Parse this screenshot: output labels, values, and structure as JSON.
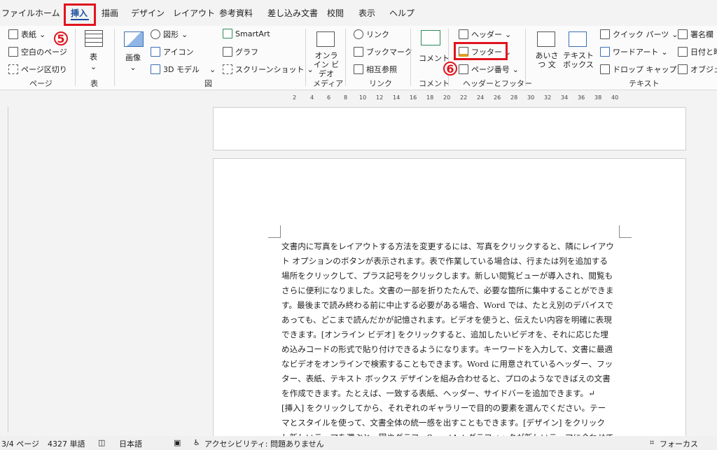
{
  "menu": {
    "tabs": [
      "ファイル",
      "ホーム",
      "挿入",
      "描画",
      "デザイン",
      "レイアウト",
      "参考資料",
      "差し込み文書",
      "校閲",
      "表示",
      "ヘルプ"
    ],
    "active": "挿入"
  },
  "ribbon": {
    "page_group": {
      "cover": "表紙",
      "blank": "空白のページ",
      "break": "ページ区切り",
      "label": "ページ"
    },
    "table_group": {
      "table": "表",
      "label": "表"
    },
    "illust_group": {
      "image": "画像",
      "shapes": "図形",
      "icons": "アイコン",
      "model3d": "3D モデル",
      "smartart": "SmartArt",
      "graph": "グラフ",
      "screenshot": "スクリーンショット",
      "label": "図"
    },
    "media_group": {
      "video": "オンライン ビデオ",
      "label": "メディア"
    },
    "link_group": {
      "link": "リンク",
      "bookmark": "ブックマーク",
      "crossref": "相互参照",
      "label": "リンク"
    },
    "comment_group": {
      "comment": "コメント",
      "label": "コメント"
    },
    "hf_group": {
      "header": "ヘッダー",
      "footer": "フッター",
      "pagenum": "ページ番号",
      "label": "ヘッダーとフッター"
    },
    "text_group": {
      "greeting": "あいさつ 文",
      "textbox": "テキスト ボックス",
      "quickparts": "クイック パーツ",
      "wordart": "ワードアート",
      "dropcap": "ドロップ キャップ",
      "signature": "署名欄",
      "datetime": "日付と時",
      "object": "オブジェク",
      "label": "テキスト"
    }
  },
  "annotations": {
    "step5": "5",
    "step6": "6"
  },
  "ruler": [
    "2",
    "4",
    "6",
    "8",
    "10",
    "12",
    "14",
    "16",
    "18",
    "20",
    "22",
    "24",
    "26",
    "28",
    "30",
    "32",
    "34",
    "36",
    "38",
    "40"
  ],
  "document": {
    "lines": [
      "文書内に写真をレイアウトする方法を変更するには、写真をクリックすると、隣にレイアウ",
      "ト オプションのボタンが表示されます。表で作業している場合は、行または列を追加する",
      "場所をクリックして、プラス記号をクリックします。新しい閲覧ビューが導入され、閲覧も",
      "さらに便利になりました。文書の一部を折りたたんで、必要な箇所に集中することができま",
      "す。最後まで読み終わる前に中止する必要がある場合、Word では、たとえ別のデバイスで",
      "あっても、どこまで読んだかが記憶されます。ビデオを使うと、伝えたい内容を明確に表現",
      "できます。[オンライン ビデオ] をクリックすると、追加したいビデオを、それに応じた埋",
      "め込みコードの形式で貼り付けできるようになります。キーワードを入力して、文書に最適",
      "なビデオをオンラインで検索することもできます。Word に用意されているヘッダー、フッ",
      "ター、表紙、テキスト ボックス デザインを組み合わせると、プロのようなできばえの文書",
      "を作成できます。たとえば、一致する表紙、ヘッダー、サイドバーを追加できます。↵",
      "[挿入] をクリックしてから、それぞれのギャラリーで目的の要素を選んでください。テー",
      "マとスタイルを使って、文書全体の統一感を出すこともできます。[デザイン] をクリック",
      "し新しいテーマを選ぶと、図やグラフ、SmartArt グラフィックが新しいテーマに合わせて"
    ]
  },
  "status": {
    "page": "3/4 ページ",
    "words": "4327 単語",
    "lang": "日本語",
    "access": "アクセシビリティ: 問題ありません",
    "focus": "フォーカス"
  }
}
